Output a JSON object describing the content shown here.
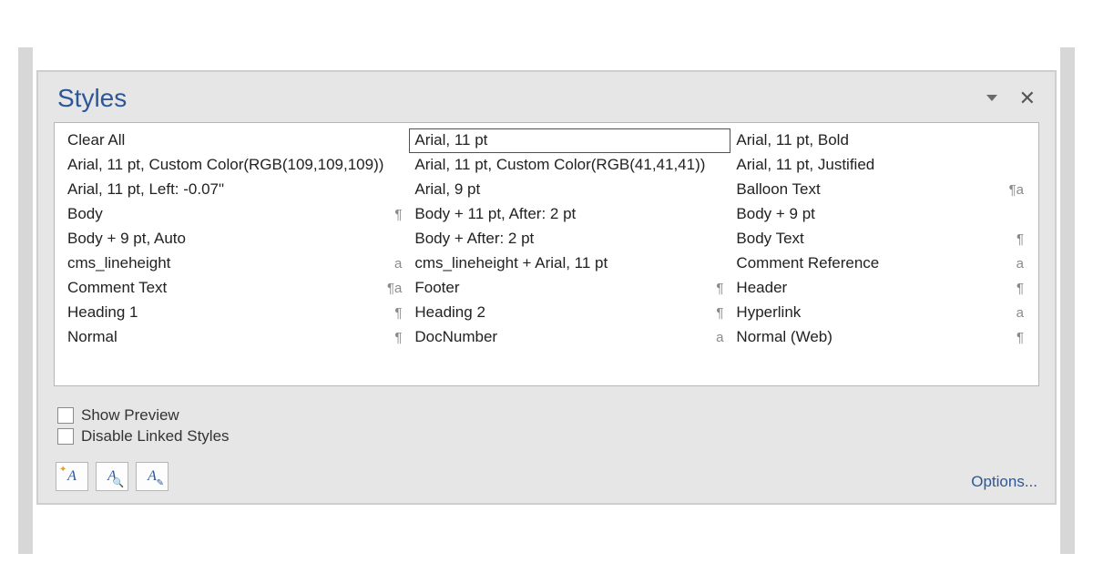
{
  "pane": {
    "title": "Styles"
  },
  "styles": {
    "col0": [
      {
        "label": "Clear All",
        "marker": ""
      },
      {
        "label": "Arial, 11 pt, Custom Color(RGB(109,109,109))",
        "marker": ""
      },
      {
        "label": "Arial, 11 pt, Left:  -0.07\"",
        "marker": ""
      },
      {
        "label": "Body",
        "marker": "¶"
      },
      {
        "label": "Body + 9 pt, Auto",
        "marker": ""
      },
      {
        "label": "cms_lineheight",
        "marker": "a"
      },
      {
        "label": "Comment Text",
        "marker": "¶a"
      },
      {
        "label": "Heading 1",
        "marker": "¶"
      },
      {
        "label": "Normal",
        "marker": "¶"
      }
    ],
    "col1": [
      {
        "label": "Arial, 11 pt",
        "marker": "",
        "selected": true
      },
      {
        "label": "Arial, 11 pt, Custom Color(RGB(41,41,41))",
        "marker": ""
      },
      {
        "label": "Arial, 9 pt",
        "marker": ""
      },
      {
        "label": "Body + 11 pt, After:  2 pt",
        "marker": ""
      },
      {
        "label": "Body + After:  2 pt",
        "marker": ""
      },
      {
        "label": "cms_lineheight + Arial, 11 pt",
        "marker": ""
      },
      {
        "label": "Footer",
        "marker": "¶"
      },
      {
        "label": "Heading 2",
        "marker": "¶"
      },
      {
        "label": "DocNumber",
        "marker": "a"
      }
    ],
    "col2": [
      {
        "label": "Arial, 11 pt, Bold",
        "marker": ""
      },
      {
        "label": "Arial, 11 pt, Justified",
        "marker": ""
      },
      {
        "label": "Balloon Text",
        "marker": "¶a"
      },
      {
        "label": "Body + 9 pt",
        "marker": ""
      },
      {
        "label": "Body Text",
        "marker": "¶"
      },
      {
        "label": "Comment Reference",
        "marker": "a"
      },
      {
        "label": "Header",
        "marker": "¶"
      },
      {
        "label": "Hyperlink",
        "marker": "a"
      },
      {
        "label": "Normal (Web)",
        "marker": "¶"
      }
    ]
  },
  "options": {
    "show_preview": "Show Preview",
    "disable_linked_styles": "Disable Linked Styles"
  },
  "buttons": {
    "new_style_glyph": "A",
    "style_inspector_glyph": "A",
    "manage_styles_glyph": "A"
  },
  "footer": {
    "options_link": "Options..."
  }
}
